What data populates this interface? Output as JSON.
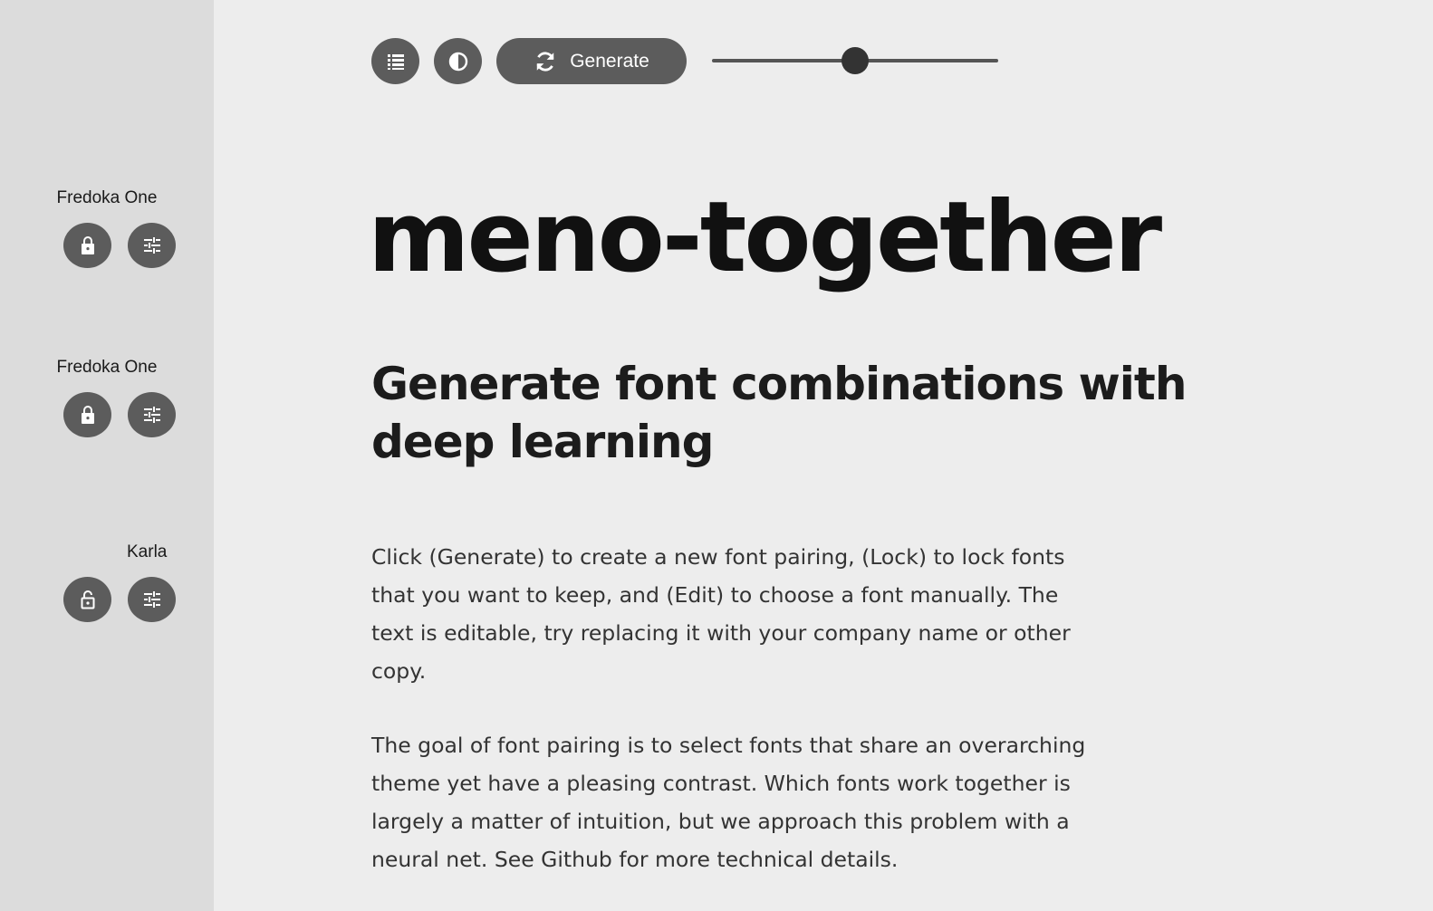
{
  "sidebar": {
    "fonts": [
      {
        "name": "Fredoka One",
        "locked": true,
        "lock_icon": "lock-icon",
        "edit_icon": "sliders-icon"
      },
      {
        "name": "Fredoka One",
        "locked": true,
        "lock_icon": "lock-icon",
        "edit_icon": "sliders-icon"
      },
      {
        "name": "Karla",
        "locked": false,
        "lock_icon": "unlock-icon",
        "edit_icon": "sliders-icon"
      }
    ]
  },
  "toolbar": {
    "list_icon": "list-icon",
    "contrast_icon": "contrast-icon",
    "generate_label": "Generate",
    "generate_icon": "refresh-icon",
    "slider_value": 0.5
  },
  "content": {
    "title": "meno-together",
    "subtitle": "Generate font combinations with deep learning",
    "paragraphs": [
      "Click (Generate) to create a new font pairing, (Lock) to lock fonts that you want to keep, and (Edit) to choose a font manually. The text is editable, try replacing it with your company name or other copy.",
      "The goal of font pairing is to select fonts that share an overarching theme yet have a pleasing contrast. Which fonts work together is largely a matter of intuition, but we approach this problem with a neural net. See Github for more technical details."
    ]
  },
  "colors": {
    "background": "#ededed",
    "sidebar": "#dcdcdc",
    "button": "#5c5c5c",
    "text": "#111111"
  }
}
